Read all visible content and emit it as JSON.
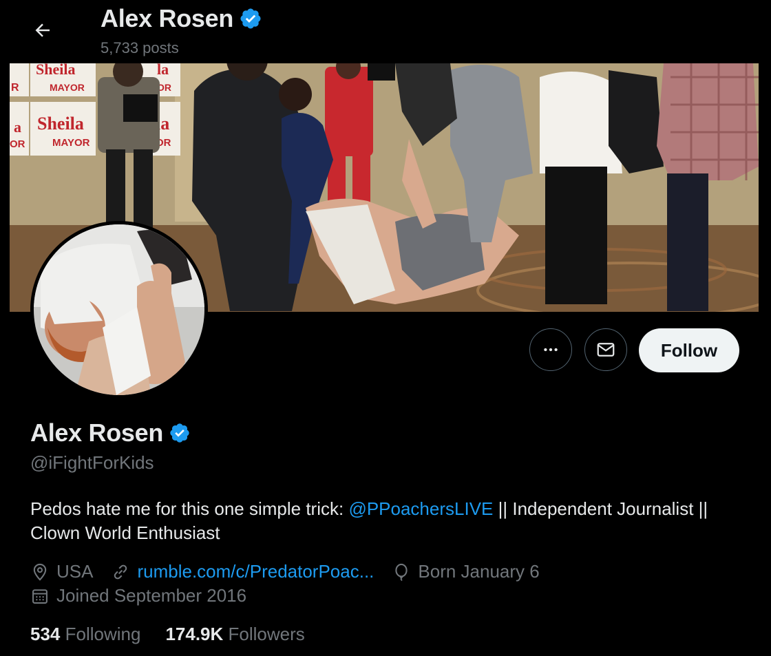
{
  "header": {
    "name": "Alex Rosen",
    "posts_count": "5,733 posts"
  },
  "banner": {
    "signs": [
      "Sheila",
      "MAYOR",
      "Sheila",
      "MAYOR",
      "la",
      "OR",
      "la",
      "OR",
      "R",
      "a",
      "OR"
    ]
  },
  "actions": {
    "follow_label": "Follow"
  },
  "profile": {
    "display_name": "Alex Rosen",
    "handle": "@iFightForKids",
    "bio_before": "Pedos hate me for this one simple trick: ",
    "bio_mention": "@PPoachersLIVE",
    "bio_after": " || Independent Journalist || Clown World Enthusiast",
    "location": "USA",
    "website": "rumble.com/c/PredatorPoac...",
    "birthday": "Born January 6",
    "joined": "Joined September 2016"
  },
  "stats": {
    "following_count": "534",
    "following_label": "Following",
    "followers_count": "174.9K",
    "followers_label": "Followers"
  },
  "colors": {
    "accent": "#1d9bf0",
    "verified": "#1d9bf0",
    "muted_text": "#71767b"
  }
}
